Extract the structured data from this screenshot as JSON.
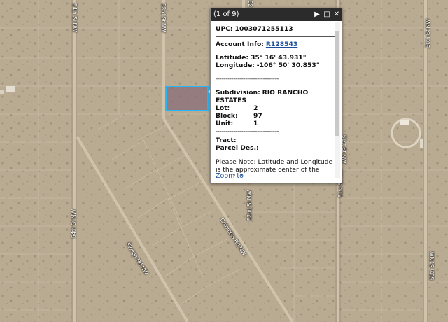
{
  "roads": {
    "st54_top": "54th St NW",
    "st53": "53rd St NW",
    "st52_top": "52",
    "st51_top": "51st St NW",
    "st50_top": "50th St NW",
    "st54_bottom": "54th St NW",
    "florida": "Florida Rd NW",
    "colombia": "Colombia Rd NW",
    "st52_bottom": "52nd St NW",
    "st51_bottom": "51st St NW",
    "st50_bottom": "50th St NW"
  },
  "popup": {
    "count": "(1 of 9)",
    "play_icon": "play-icon",
    "maximize_icon": "maximize-icon",
    "close_icon": "close-icon",
    "upc_label": "UPC:",
    "upc_value": "1003071255113",
    "account_label": "Account Info:",
    "account_value": "R128543",
    "lat_label": "Latitude:",
    "lat_value": "35° 16' 43.931\"",
    "lon_label": "Longitude:",
    "lon_value": "-106° 50' 30.853\"",
    "divider": "--------------------------------",
    "subdivision_label": "Subdivision:",
    "subdivision_value": "RIO RANCHO ESTATES",
    "lot_label": "Lot:",
    "lot_value": "2",
    "block_label": "Block:",
    "block_value": "97",
    "unit_label": "Unit:",
    "unit_value": "1",
    "tract_label": "Tract:",
    "parcel_label": "Parcel Des.:",
    "note": "Please Note: Latitude and Longitude is the approximate center of the parcel shown.",
    "zoom_link": "Zoom to"
  },
  "colors": {
    "selection": "#29b6f6",
    "terrain": "#b8a890",
    "popup_header": "#2b2b2b"
  }
}
